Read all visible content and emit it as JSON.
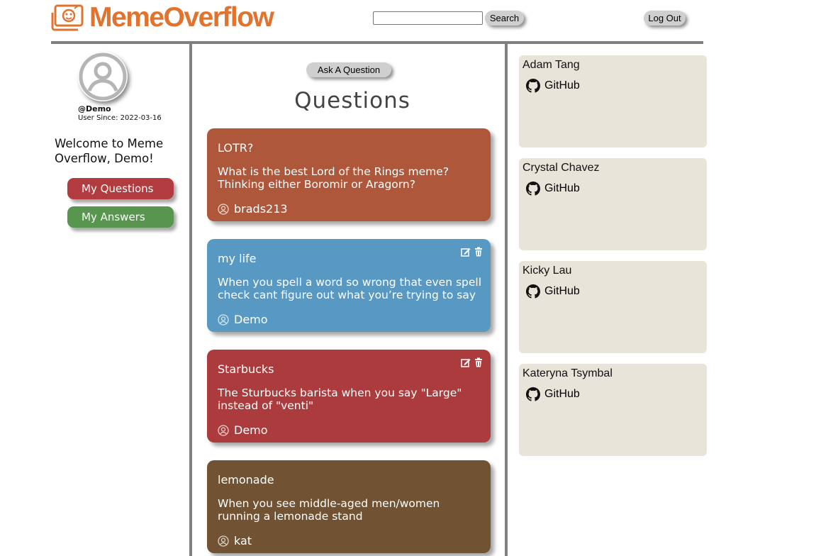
{
  "header": {
    "brand": "MemeOverflow",
    "logo_icon": "laptop-meme-icon",
    "brand_color": "#e2732f",
    "search": {
      "value": "",
      "placeholder": "",
      "button_label": "Search"
    },
    "logout_label": "Log Out"
  },
  "sidebar": {
    "avatar_icon": "user-avatar-icon",
    "username": "@Demo",
    "user_since": "User Since: 2022-03-16",
    "welcome": "Welcome to Meme Overflow, Demo!",
    "my_questions_label": "My Questions",
    "my_answers_label": "My Answers",
    "my_questions_color": "#b13b3f",
    "my_answers_color": "#58954f"
  },
  "main": {
    "ask_label": "Ask A Question",
    "title": "Questions",
    "questions": [
      {
        "title": "LOTR?",
        "body": "What is the best Lord of the Rings meme? Thinking either Boromir or Aragorn?",
        "author": "brads213",
        "color": "#ae573a",
        "editable": false
      },
      {
        "title": "my life",
        "body": "When you spell a word so wrong that even spell check cant figure out what you’re trying to say",
        "author": "Demo",
        "color": "#5899c3",
        "editable": true
      },
      {
        "title": "Starbucks",
        "body": "The Sturbucks barista when you say \"Large\" instead of \"venti\"",
        "author": "Demo",
        "color": "#ab3b3d",
        "editable": true
      },
      {
        "title": "lemonade",
        "body": "When you see middle-aged men/women running a lemonade stand",
        "author": "kat",
        "color": "#715232",
        "editable": false
      }
    ]
  },
  "developers": [
    {
      "name": "Adam Tang",
      "link": "GitHub"
    },
    {
      "name": "Crystal Chavez",
      "link": "GitHub"
    },
    {
      "name": "Kicky Lau",
      "link": "GitHub"
    },
    {
      "name": "Kateryna Tsymbal",
      "link": "GitHub"
    }
  ],
  "colors": {
    "dev_card_bg": "#e8e4d9",
    "divider": "#808080"
  }
}
